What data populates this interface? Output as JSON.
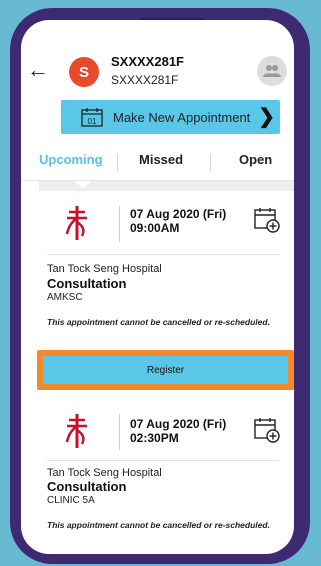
{
  "header": {
    "back_glyph": "←",
    "avatar_letter": "S",
    "user_name": "SXXXX281F",
    "user_id": "SXXXX281F",
    "brand_color": "#e84b2c"
  },
  "new_appointment": {
    "label": "Make New Appointment",
    "calendar_day": "01",
    "chevron": "❯"
  },
  "tabs": [
    "Upcoming",
    "Missed",
    "Open"
  ],
  "active_tab": "Upcoming",
  "accent_color": "#5bc7e8",
  "appointments": [
    {
      "date": "07 Aug 2020 (Fri)",
      "time": "09:00AM",
      "hospital": "Tan Tock Seng Hospital",
      "type": "Consultation",
      "clinic": "AMKSC",
      "note": "This appointment cannot be cancelled or re-scheduled.",
      "action": "Register"
    },
    {
      "date": "07 Aug 2020 (Fri)",
      "time": "02:30PM",
      "hospital": "Tan Tock Seng Hospital",
      "type": "Consultation",
      "clinic": "CLINIC 5A",
      "note": "This appointment cannot be cancelled or re-scheduled."
    }
  ],
  "highlight_color": "#f08a2c",
  "icons": [
    "back-arrow-icon",
    "switch-profile-icon",
    "calendar-icon",
    "chevron-right-icon",
    "hospital-logo-icon",
    "add-to-calendar-icon"
  ]
}
